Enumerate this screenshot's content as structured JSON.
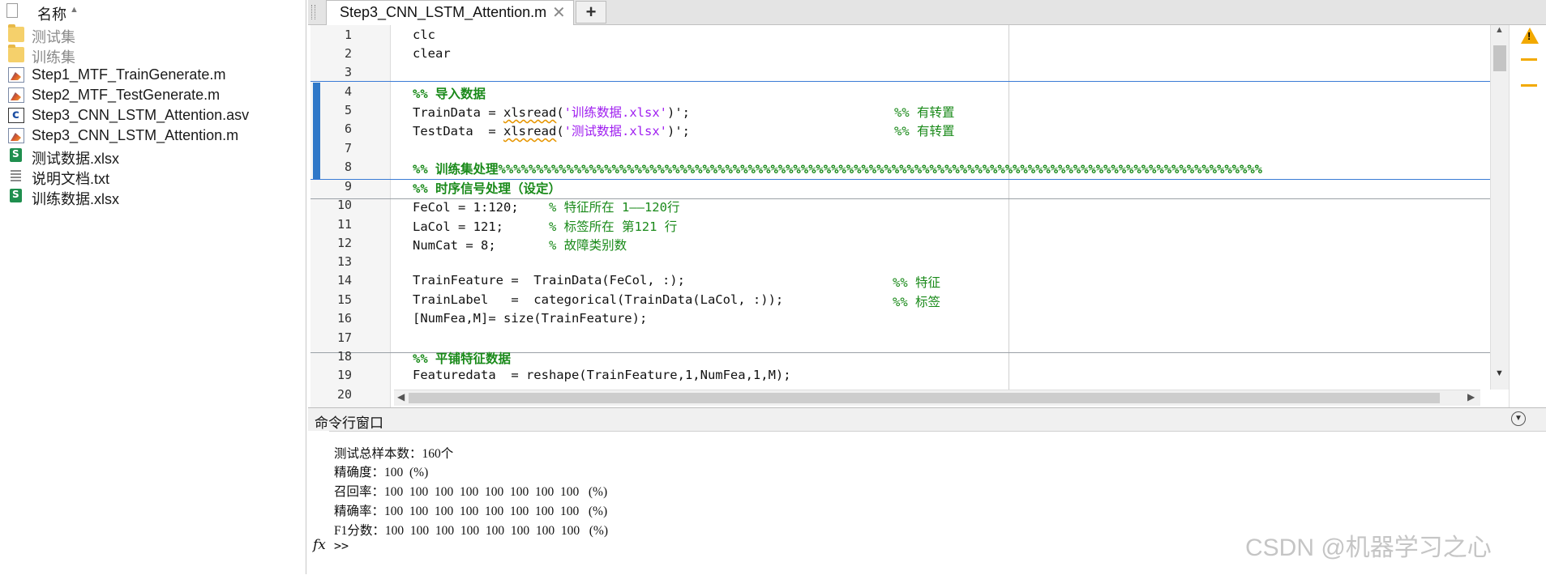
{
  "file_browser": {
    "header_label": "名称",
    "files": [
      {
        "name": "测试集",
        "type": "folder",
        "icon": "folder-icon"
      },
      {
        "name": "训练集",
        "type": "folder",
        "icon": "folder-icon"
      },
      {
        "name": "Step1_MTF_TrainGenerate.m",
        "type": "m",
        "icon": "matlab-file-icon"
      },
      {
        "name": "Step2_MTF_TestGenerate.m",
        "type": "m",
        "icon": "matlab-file-icon"
      },
      {
        "name": "Step3_CNN_LSTM_Attention.asv",
        "type": "asv",
        "icon": "asv-file-icon"
      },
      {
        "name": "Step3_CNN_LSTM_Attention.m",
        "type": "m",
        "icon": "matlab-file-icon"
      },
      {
        "name": "测试数据.xlsx",
        "type": "xlsx",
        "icon": "excel-file-icon"
      },
      {
        "name": "说明文档.txt",
        "type": "txt",
        "icon": "text-file-icon"
      },
      {
        "name": "训练数据.xlsx",
        "type": "xlsx",
        "icon": "excel-file-icon"
      }
    ]
  },
  "editor": {
    "tab_title": "Step3_CNN_LSTM_Attention.m",
    "new_tab_label": "+",
    "lines": [
      {
        "n": "1",
        "code": "clc"
      },
      {
        "n": "2",
        "code": "clear"
      },
      {
        "n": "3",
        "code": ""
      },
      {
        "n": "4",
        "code": "%% 导入数据"
      },
      {
        "n": "5",
        "code_a": "TrainData = ",
        "fn": "xlsread",
        "code_b": "(",
        "str": "'训练数据.xlsx'",
        "code_c": ")';",
        "comment": "%% 有转置"
      },
      {
        "n": "6",
        "code_a": "TestData  = ",
        "fn": "xlsread",
        "code_b": "(",
        "str": "'测试数据.xlsx'",
        "code_c": ")';",
        "comment": "%% 有转置"
      },
      {
        "n": "7",
        "code": ""
      },
      {
        "n": "8",
        "code": "%% 训练集处理%%%%%%%%%%%%%%%%%%%%%%%%%%%%%%%%%%%%%%%%%%%%%%%%%%%%%%%%%%%%%%%%%%%%%%%%%%%%%%%%%%%%%%%%%%%%%%%%%%%%%"
      },
      {
        "n": "9",
        "code": "%% 时序信号处理（设定）"
      },
      {
        "n": "10",
        "code": "FeCol = 1:120;    ",
        "comment_inline": "% 特征所在 1——120行"
      },
      {
        "n": "11",
        "code": "LaCol = 121;      ",
        "comment_inline": "% 标签所在 第121 行"
      },
      {
        "n": "12",
        "code": "NumCat = 8;       ",
        "comment_inline": "% 故障类别数"
      },
      {
        "n": "13",
        "code": ""
      },
      {
        "n": "14",
        "code": "TrainFeature =  TrainData(FeCol, :);",
        "comment": "%% 特征"
      },
      {
        "n": "15",
        "code": "TrainLabel   =  categorical(TrainData(LaCol, :));",
        "comment": "%% 标签"
      },
      {
        "n": "16",
        "code": "[NumFea,M]= size(TrainFeature);"
      },
      {
        "n": "17",
        "code": ""
      },
      {
        "n": "18",
        "code": "%% 平铺特征数据"
      },
      {
        "n": "19",
        "code": "Featuredata  = reshape(TrainFeature,1,NumFea,1,M);"
      },
      {
        "n": "20",
        "code": ""
      }
    ]
  },
  "command_window": {
    "title": "命令行窗口",
    "output": [
      "测试总样本数：160个",
      "精确度：100  (%)",
      "召回率：100  100  100  100  100  100  100  100   (%)",
      "精确率：100  100  100  100  100  100  100  100   (%)",
      "F1分数：100  100  100  100  100  100  100  100   (%)"
    ],
    "fx_label": "fx",
    "prompt": ">>"
  },
  "watermark": "CSDN @机器学习之心",
  "colors": {
    "comment": "#1a8a1a",
    "string": "#a020f0",
    "cell_bar": "#2f78c8",
    "warning": "#f2a900"
  }
}
